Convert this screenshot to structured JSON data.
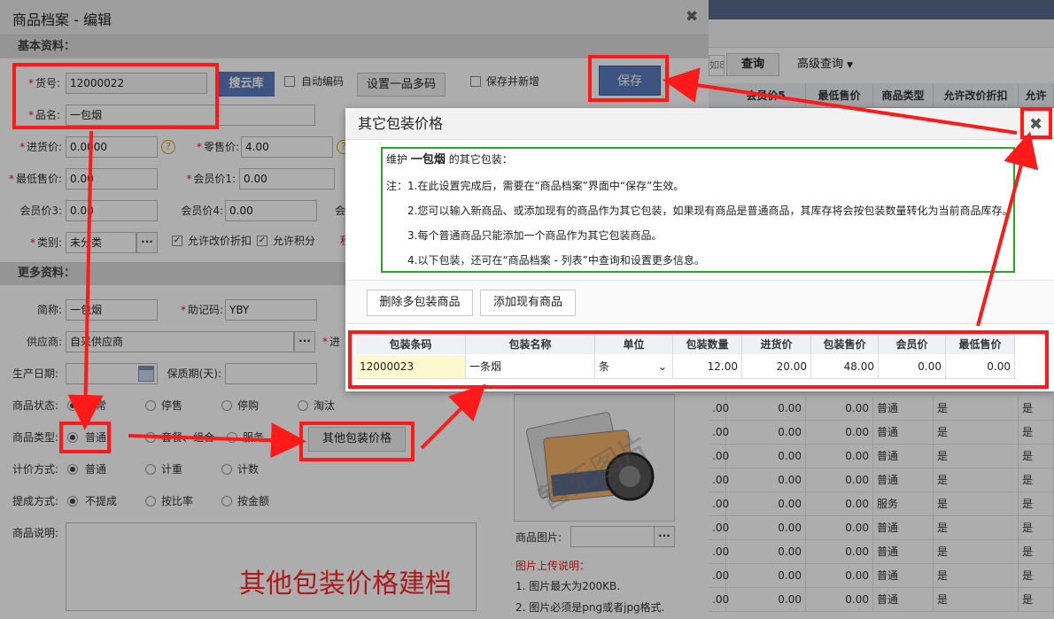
{
  "colors": {
    "accent": "#5b7bbf",
    "annotation_red": "#ff1a1a",
    "note_green": "#22aa22",
    "required_red": "#e02020"
  },
  "background": {
    "toolbar": {
      "query_label": "查询",
      "advanced_query_label": "高级查询",
      "dropdown_icon": "caret-down-icon",
      "cut_input_text": "如8"
    },
    "table_header": [
      "会员价5",
      "最低售价",
      "商品类型",
      "允许改价折扣",
      "允许"
    ],
    "rows": [
      {
        "c1": ".00",
        "c2": "0.00",
        "c3": "0.00",
        "type": "普通",
        "allow": "是",
        "allow2": "是"
      },
      {
        "c1": ".00",
        "c2": "0.00",
        "c3": "0.00",
        "type": "普通",
        "allow": "是",
        "allow2": "是"
      },
      {
        "c1": ".00",
        "c2": "0.00",
        "c3": "0.00",
        "type": "普通",
        "allow": "是",
        "allow2": "是"
      },
      {
        "c1": ".00",
        "c2": "0.00",
        "c3": "0.00",
        "type": "普通",
        "allow": "是",
        "allow2": "是"
      },
      {
        "c1": ".00",
        "c2": "0.00",
        "c3": "0.00",
        "type": "服务",
        "allow": "是",
        "allow2": "是"
      },
      {
        "c1": ".00",
        "c2": "0.00",
        "c3": "0.00",
        "type": "普通",
        "allow": "是",
        "allow2": "是"
      },
      {
        "c1": ".00",
        "c2": "0.00",
        "c3": "0.00",
        "type": "普通",
        "allow": "是",
        "allow2": "是"
      },
      {
        "c1": ".00",
        "c2": "0.00",
        "c3": "0.00",
        "type": "普通",
        "allow": "是",
        "allow2": "是"
      },
      {
        "c1": ".00",
        "c2": "0.00",
        "c3": "0.00",
        "type": "普通",
        "allow": "是",
        "allow2": "是"
      }
    ]
  },
  "dialog": {
    "title": "商品档案 - 编辑",
    "close_icon": "close-icon",
    "section_basic": "基本资料：",
    "section_more": "更多资料：",
    "item_no": {
      "label": "货号:",
      "value": "12000022"
    },
    "search_cloud_button": "搜云库",
    "auto_code_label": "自动编码",
    "multi_code_button": "设置一品多码",
    "save_and_new_label": "保存并新增",
    "save_button": "保存",
    "name": {
      "label": "品名:",
      "value": "一包烟"
    },
    "purchase_price": {
      "label": "进货价:",
      "value": "0.0000"
    },
    "retail_price": {
      "label": "零售价:",
      "value": "4.00"
    },
    "min_price": {
      "label": "最低售价:",
      "value": "0.00"
    },
    "member_price1": {
      "label": "会员价1:",
      "value": "0.00"
    },
    "member_price3": {
      "label": "会员价3:",
      "value": "0.00"
    },
    "member_price4": {
      "label": "会员价4:",
      "value": "0.00"
    },
    "member_price_cut": "会",
    "category": {
      "label": "类别:",
      "value": "未分类",
      "cut": "积"
    },
    "allow_discount_label": "允许改价折扣",
    "allow_points_label": "允许积分",
    "short_name": {
      "label": "简称:",
      "value": "一包烟"
    },
    "mnemonic": {
      "label": "助记码:",
      "value": "YBY"
    },
    "supplier": {
      "label": "供应商:",
      "value": "自采供应商",
      "cut": "进"
    },
    "production_date": {
      "label": "生产日期:",
      "value": ""
    },
    "shelf_life": {
      "label": "保质期(天):",
      "value": ""
    },
    "calendar_icon": "calendar-icon",
    "status": {
      "label": "商品状态:",
      "options": [
        "正常",
        "停售",
        "停购",
        "淘汰"
      ],
      "selected": 0
    },
    "product_type": {
      "label": "商品类型:",
      "options": [
        "普通",
        "套餐、组合",
        "服务"
      ],
      "selected": 0
    },
    "other_pack_button": "其他包装价格",
    "pricing": {
      "label": "计价方式:",
      "options": [
        "普通",
        "计重",
        "计数"
      ],
      "selected": 0
    },
    "commission": {
      "label": "提成方式:",
      "options": [
        "不提成",
        "按比率",
        "按金额"
      ],
      "selected": 0
    },
    "description": {
      "label": "商品说明:",
      "value": ""
    },
    "image": {
      "placeholder_text": "暂无图片",
      "label": "商品图片:",
      "notes_title": "图片上传说明：",
      "notes": [
        "1. 图片最大为200KB.",
        "2. 图片必须是png或者jpg格式."
      ]
    },
    "annotation_caption": "其他包装价格建档"
  },
  "popup": {
    "title": "其它包装价格",
    "close_icon": "close-icon",
    "intro_prefix": "维护",
    "intro_name": "一包烟",
    "intro_suffix": "的其它包装：",
    "notes": [
      "注：1.在此设置完成后，需要在“商品档案”界面中“保存”生效。",
      "2.您可以输入新商品、或添加现有的商品作为其它包装，如果现有商品是普通商品，其库存将会按包装数量转化为当前商品库存。",
      "3.每个普通商品只能添加一个商品作为其它包装商品。",
      "4.以下包装，还可在“商品档案 - 列表”中查询和设置更多信息。"
    ],
    "delete_button": "删除多包装商品",
    "add_existing_button": "添加现有商品",
    "columns": [
      "包装条码",
      "包装名称",
      "单位",
      "包装数量",
      "进货价",
      "包装售价",
      "会员价",
      "最低售价"
    ],
    "row": {
      "barcode": "12000023",
      "name": "一条烟",
      "unit": "条",
      "qty": "12.00",
      "cost": "20.00",
      "price": "48.00",
      "member": "0.00",
      "min": "0.00"
    }
  }
}
